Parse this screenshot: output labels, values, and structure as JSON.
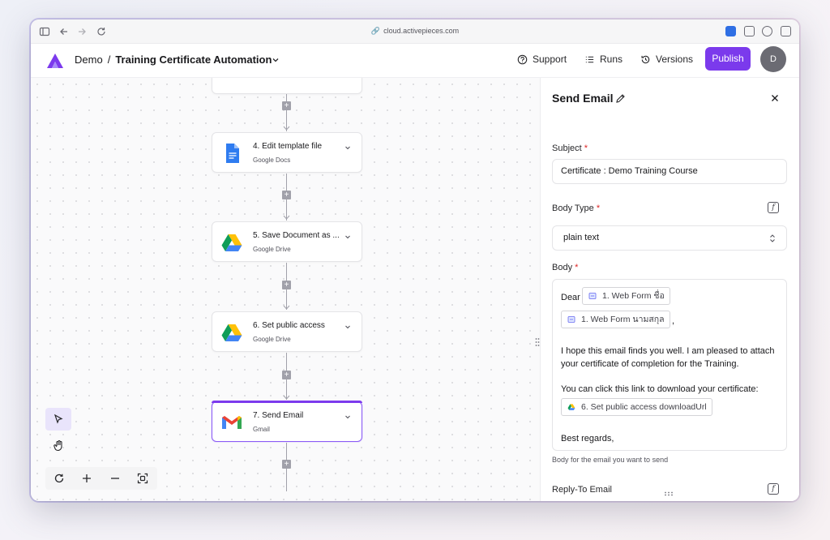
{
  "browser": {
    "url": "cloud.activepieces.com"
  },
  "header": {
    "project": "Demo",
    "separator": "/",
    "flow_name": "Training Certificate Automation",
    "support_label": "Support",
    "runs_label": "Runs",
    "versions_label": "Versions",
    "publish_label": "Publish",
    "avatar_initial": "D",
    "accent_color": "#7b3aec"
  },
  "canvas": {
    "nodes": [
      {
        "title": "4. Edit template file",
        "subtitle": "Google Docs",
        "icon": "google-docs-icon"
      },
      {
        "title": "5. Save Document as ...",
        "subtitle": "Google Drive",
        "icon": "google-drive-icon"
      },
      {
        "title": "6. Set public access",
        "subtitle": "Google Drive",
        "icon": "google-drive-icon"
      },
      {
        "title": "7. Send Email",
        "subtitle": "Gmail",
        "icon": "gmail-icon",
        "selected": true
      }
    ],
    "tools": [
      "pointer-icon",
      "hand-icon"
    ],
    "zoom_controls": [
      "reset-icon",
      "zoom-in-icon",
      "zoom-out-icon",
      "fit-view-icon"
    ]
  },
  "panel": {
    "title": "Send Email",
    "subject_label": "Subject",
    "subject_value": "Certificate : Demo Training Course",
    "body_type_label": "Body Type",
    "body_type_value": "plain text",
    "body_label": "Body",
    "body": {
      "greeting": "Dear",
      "chip_first_name": "1. Web Form ชื่อ",
      "chip_last_name": "1. Web Form นามสกุล",
      "comma": ",",
      "line1": "I hope this email finds you well. I am pleased to attach",
      "line2": "your certificate of completion for the Training.",
      "line3": "You can click this link to download your certificate:",
      "chip_download": "6. Set public access downloadUrl",
      "closing": "Best regards,"
    },
    "body_helper": "Body for the email you want to send",
    "reply_to_label": "Reply-To Email",
    "required_mark": "*"
  }
}
